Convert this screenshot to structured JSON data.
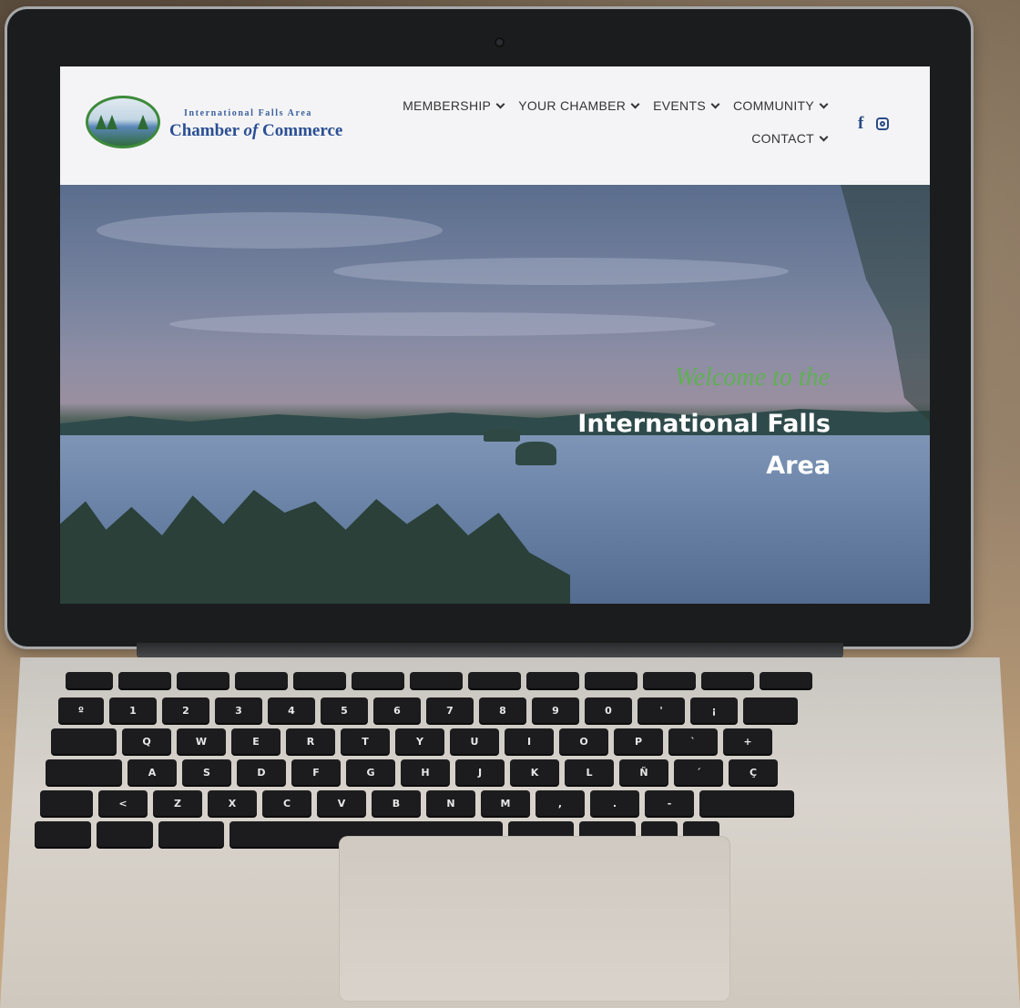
{
  "site": {
    "logo": {
      "small_text": "International Falls Area",
      "big_text_1": "Chamber ",
      "big_text_of": "of",
      "big_text_2": " Commerce"
    },
    "nav_row_1": [
      "MEMBERSHIP",
      "YOUR CHAMBER",
      "EVENTS",
      "COMMUNITY"
    ],
    "nav_row_2": [
      "CONTACT"
    ],
    "social": [
      "facebook-icon",
      "instagram-icon"
    ],
    "hero": {
      "welcome": "Welcome to the",
      "title_line_1": "International Falls",
      "title_line_2": "Area"
    }
  },
  "keyboard_rows": [
    [
      "",
      "",
      "",
      "",
      "",
      "",
      "",
      "",
      "",
      "",
      "",
      "",
      ""
    ],
    [
      "º",
      "1",
      "2",
      "3",
      "4",
      "5",
      "6",
      "7",
      "8",
      "9",
      "0",
      "'",
      "¡",
      ""
    ],
    [
      "",
      "Q",
      "W",
      "E",
      "R",
      "T",
      "Y",
      "U",
      "I",
      "O",
      "P",
      "`",
      "+"
    ],
    [
      "",
      "A",
      "S",
      "D",
      "F",
      "G",
      "H",
      "J",
      "K",
      "L",
      "Ñ",
      "´",
      "Ç"
    ],
    [
      "",
      "<",
      "Z",
      "X",
      "C",
      "V",
      "B",
      "N",
      "M",
      ",",
      ".",
      "-",
      ""
    ],
    [
      "",
      "",
      "",
      "",
      "",
      "",
      "",
      ""
    ]
  ],
  "colors": {
    "nav_text": "#333333",
    "logo_blue": "#2a4f93",
    "welcome_green": "#5fb053",
    "hero_title": "#ffffff"
  }
}
